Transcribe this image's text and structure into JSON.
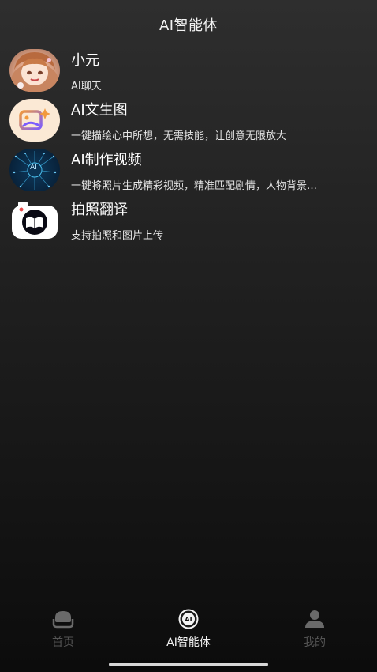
{
  "header": {
    "title": "AI智能体"
  },
  "agents": [
    {
      "name": "小元",
      "desc": "AI聊天",
      "icon": "anime-girl-avatar"
    },
    {
      "name": "AI文生图",
      "desc": "一键描绘心中所想，无需技能，让创意无限放大",
      "icon": "image-sparkle-icon"
    },
    {
      "name": "AI制作视频",
      "desc": "一键将照片生成精彩视频，精准匹配剧情，人物背景…",
      "icon": "ai-network-icon",
      "badge": "AI"
    },
    {
      "name": "拍照翻译",
      "desc": "支持拍照和图片上传",
      "icon": "camera-book-icon"
    }
  ],
  "tabbar": {
    "items": [
      {
        "label": "首页",
        "icon": "home-icon",
        "active": false
      },
      {
        "label": "AI智能体",
        "icon": "ai-badge-icon",
        "badge": "AI",
        "active": true
      },
      {
        "label": "我的",
        "icon": "user-icon",
        "active": false
      }
    ]
  },
  "colors": {
    "active": "#f2f2f2",
    "inactive": "#555555",
    "accent_orange": "#f29a3c",
    "accent_purple": "#7b5cff"
  }
}
